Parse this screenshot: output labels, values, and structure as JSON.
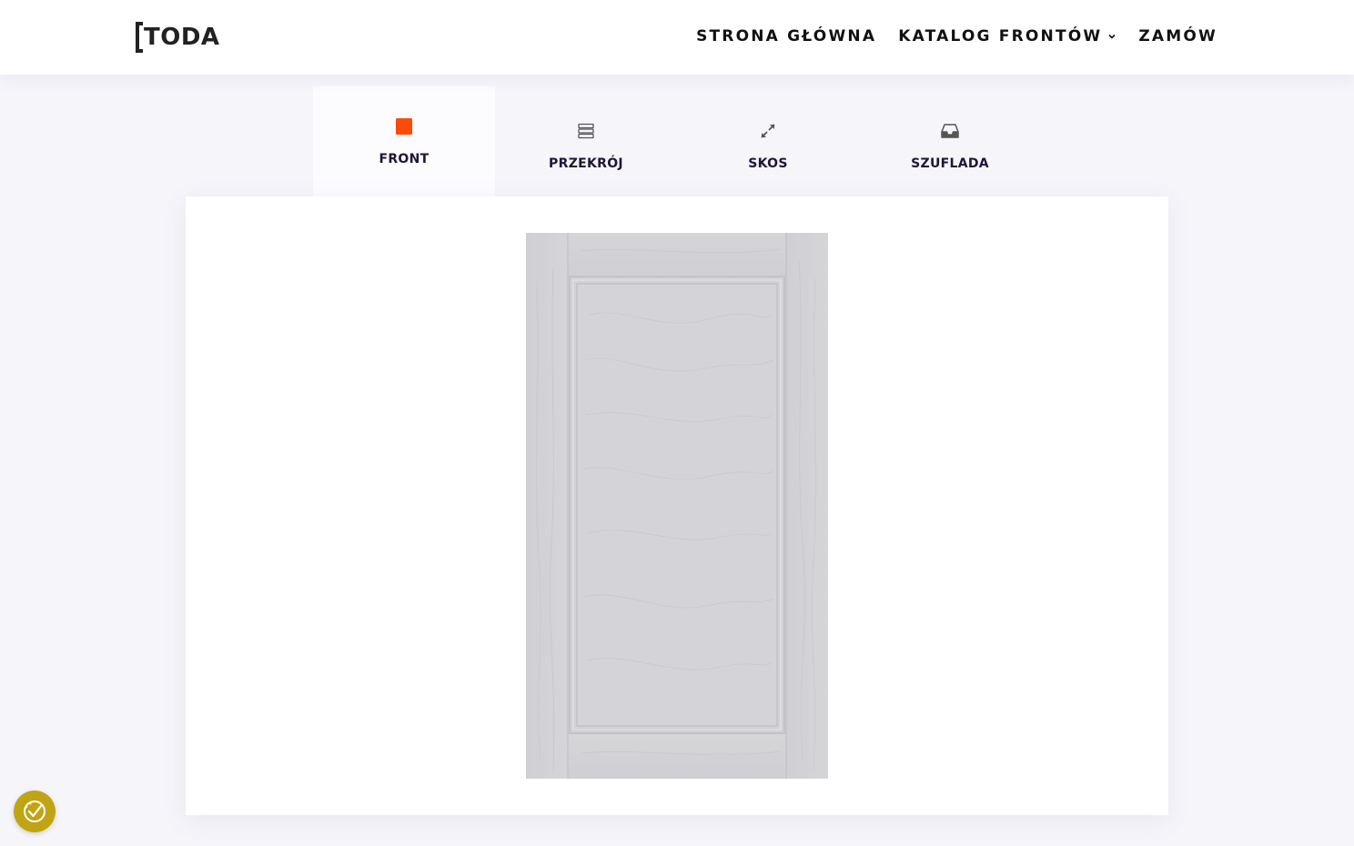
{
  "header": {
    "logo_text": "TODA",
    "nav": [
      {
        "label": "STRONA GŁÓWNA"
      },
      {
        "label": "KATALOG FRONTÓW",
        "has_dropdown": true
      },
      {
        "label": "ZAMÓW"
      }
    ]
  },
  "tabs": [
    {
      "label": "FRONT",
      "icon": "square-icon",
      "active": true
    },
    {
      "label": "PRZEKRÓJ",
      "icon": "layers-icon",
      "active": false
    },
    {
      "label": "SKOS",
      "icon": "expand-arrows-icon",
      "active": false
    },
    {
      "label": "SZUFLADA",
      "icon": "inbox-drawer-icon",
      "active": false
    }
  ],
  "colors": {
    "accent": "#fc4b08",
    "tab_text": "#1f1537",
    "page_bg": "#f6f5fa",
    "cookie_bg": "#c0a414",
    "door_color": "#d3d3d6"
  },
  "cookie": {
    "icon": "cookie-consent-icon"
  }
}
